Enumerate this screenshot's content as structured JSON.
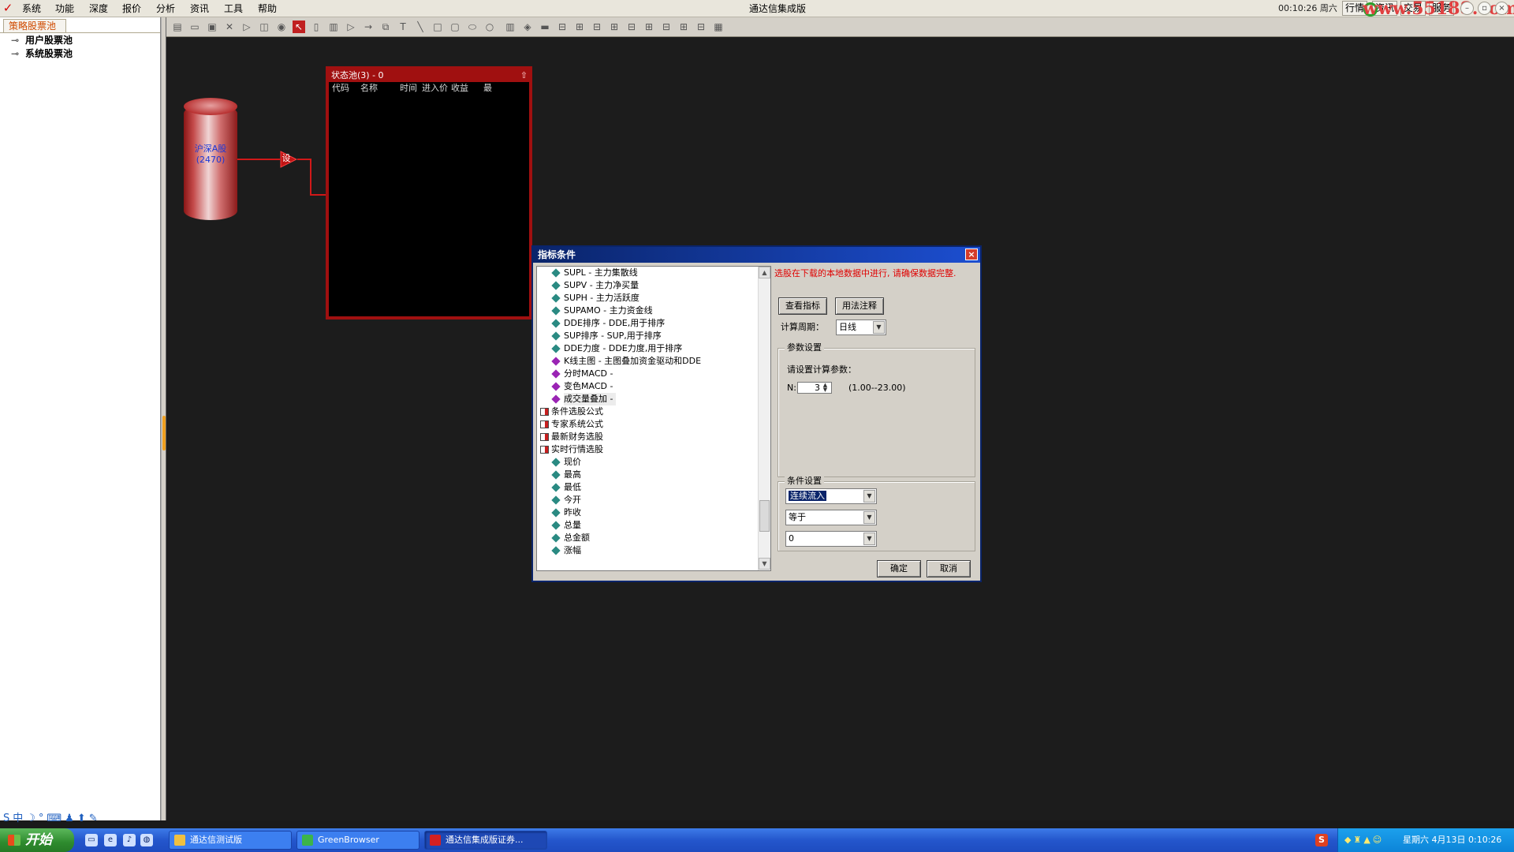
{
  "app": {
    "title": "通达信集成版",
    "menus": [
      "系统",
      "功能",
      "深度",
      "报价",
      "分析",
      "资讯",
      "工具",
      "帮助"
    ],
    "clock": "00:10:26 周六",
    "right_buttons": [
      "行情",
      "资讯",
      "交易",
      "服务"
    ],
    "watermark": "www.55188.com"
  },
  "left_panel": {
    "tab": "策略股票池",
    "nodes": [
      "用户股票池",
      "系统股票池"
    ]
  },
  "canvas": {
    "source": {
      "name": "沪深A股",
      "count": "(2470)"
    },
    "setup_node": "设",
    "pool": {
      "title": "状态池(3) - 0",
      "columns": [
        "代码",
        "名称",
        "时间",
        "进入价",
        "收益",
        "最"
      ]
    }
  },
  "dialog": {
    "title": "指标条件",
    "notice": "选股在下载的本地数据中进行, 请确保数据完整.",
    "buttons": {
      "view": "查看指标",
      "usage": "用法注释",
      "ok": "确定",
      "cancel": "取消"
    },
    "period_label": "计算周期：",
    "period_value": "日线",
    "param_group": "参数设置",
    "param_prompt": "请设置计算参数：",
    "param_name": "N:",
    "param_value": "3",
    "param_range": "(1.00--23.00)",
    "cond_group": "条件设置",
    "cond_field": "连续流入",
    "cond_op": "等于",
    "cond_value": "0",
    "tree": [
      {
        "label": "SUPL - 主力集散线",
        "icon": "teal",
        "indent": 2
      },
      {
        "label": "SUPV - 主力净买量",
        "icon": "teal",
        "indent": 2
      },
      {
        "label": "SUPH - 主力活跃度",
        "icon": "teal",
        "indent": 2
      },
      {
        "label": "SUPAMO - 主力资金线",
        "icon": "teal",
        "indent": 2
      },
      {
        "label": "DDE排序 - DDE,用于排序",
        "icon": "teal",
        "indent": 2
      },
      {
        "label": "SUP排序 - SUP,用于排序",
        "icon": "teal",
        "indent": 2
      },
      {
        "label": "DDE力度 - DDE力度,用于排序",
        "icon": "teal",
        "indent": 2
      },
      {
        "label": "K线主图 - 主图叠加资金驱动和DDE",
        "icon": "mag",
        "indent": 2
      },
      {
        "label": "分时MACD -",
        "icon": "mag",
        "indent": 2
      },
      {
        "label": "变色MACD -",
        "icon": "mag",
        "indent": 2
      },
      {
        "label": "成交量叠加 -",
        "icon": "mag",
        "indent": 2,
        "selected": true
      },
      {
        "label": "条件选股公式",
        "icon": "book",
        "indent": 1
      },
      {
        "label": "专家系统公式",
        "icon": "book",
        "indent": 1
      },
      {
        "label": "最新财务选股",
        "icon": "book",
        "indent": 1
      },
      {
        "label": "实时行情选股",
        "icon": "book",
        "indent": 1
      },
      {
        "label": "现价",
        "icon": "teal",
        "indent": 2
      },
      {
        "label": "最高",
        "icon": "teal",
        "indent": 2
      },
      {
        "label": "最低",
        "icon": "teal",
        "indent": 2
      },
      {
        "label": "今开",
        "icon": "teal",
        "indent": 2
      },
      {
        "label": "昨收",
        "icon": "teal",
        "indent": 2
      },
      {
        "label": "总量",
        "icon": "teal",
        "indent": 2
      },
      {
        "label": "总金额",
        "icon": "teal",
        "indent": 2
      },
      {
        "label": "涨幅",
        "icon": "teal",
        "indent": 2
      }
    ]
  },
  "taskbar": {
    "start": "开始",
    "tasks": [
      "通达信测试版",
      "GreenBrowser",
      "通达信集成版证券..."
    ],
    "clock": "星期六 4月13日 0:10:26"
  },
  "colors": {
    "accent_red": "#a01010",
    "dialog_title": "#0a246a",
    "canvas_bg": "#1c1c1c"
  }
}
